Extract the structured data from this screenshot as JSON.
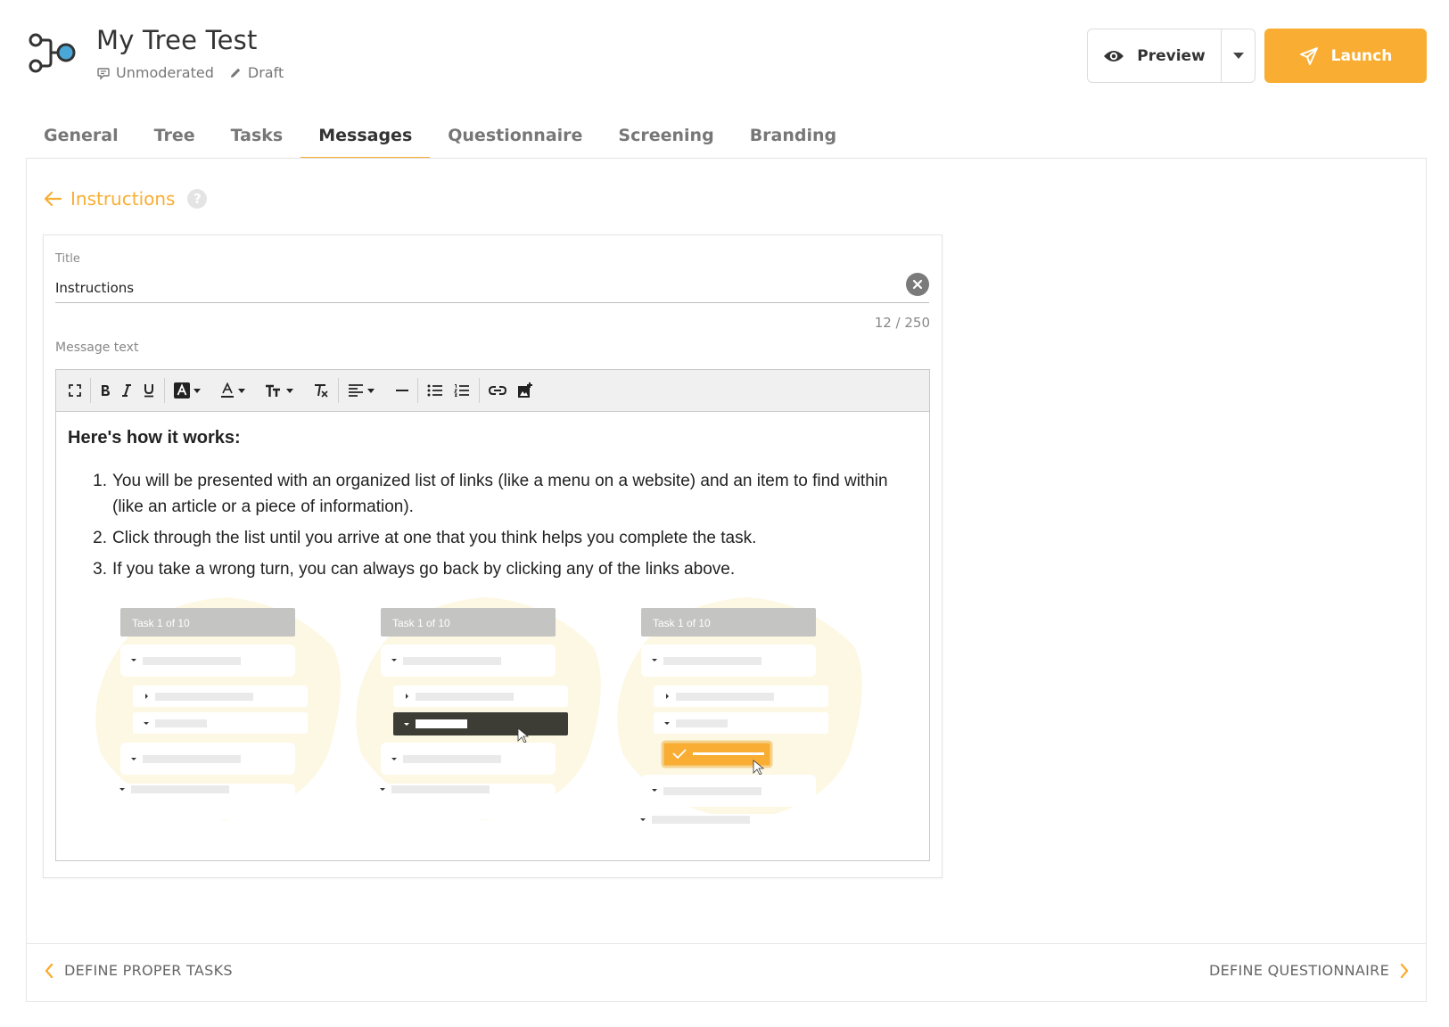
{
  "header": {
    "title": "My Tree Test",
    "mode": "Unmoderated",
    "status": "Draft",
    "preview_label": "Preview",
    "launch_label": "Launch",
    "accent_color": "#f9ae33"
  },
  "tabs": [
    {
      "label": "General"
    },
    {
      "label": "Tree"
    },
    {
      "label": "Tasks"
    },
    {
      "label": "Messages",
      "active": true
    },
    {
      "label": "Questionnaire"
    },
    {
      "label": "Screening"
    },
    {
      "label": "Branding"
    }
  ],
  "section": {
    "back_label": "Instructions",
    "help": "?"
  },
  "editor": {
    "title_label": "Title",
    "title_value": "Instructions",
    "counter": "12 / 250",
    "message_label": "Message text",
    "body": {
      "heading": "Here's how it works:",
      "items": [
        {
          "num": "1.",
          "text": "You will be presented with an organized list of links (like a menu on a website) and an item to find within (like an article or a piece of information)."
        },
        {
          "num": "2.",
          "text": "Click through the list until you arrive at one that you think helps you complete the task."
        },
        {
          "num": "3.",
          "text": "If you take a wrong turn, you can always go back by clicking any of the links above."
        }
      ]
    },
    "illustration": {
      "task_labels": [
        "Task 1 of 10",
        "Task 1 of 10",
        "Task 1 of 10"
      ]
    },
    "toolbar": [
      "fullscreen-icon",
      "bold-icon",
      "italic-icon",
      "underline-icon",
      "highlight-color-icon",
      "font-color-icon",
      "font-size-icon",
      "clear-format-icon",
      "align-icon",
      "horizontal-rule-icon",
      "bullet-list-icon",
      "numbered-list-icon",
      "link-icon",
      "insert-image-icon"
    ]
  },
  "footer": {
    "prev_label": "DEFINE PROPER TASKS",
    "next_label": "DEFINE QUESTIONNAIRE"
  }
}
